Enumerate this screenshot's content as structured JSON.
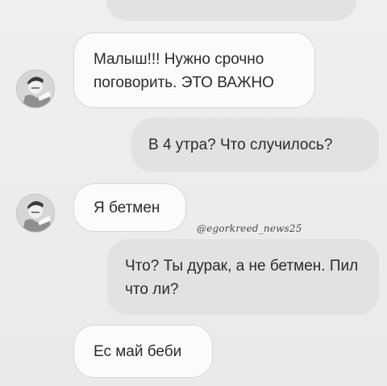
{
  "messages": [
    {
      "from": "them",
      "text": "Малыш!!! Нужно срочно поговорить. ЭТО ВАЖНО"
    },
    {
      "from": "me",
      "text": "В 4 утра? Что случилось?"
    },
    {
      "from": "them",
      "text": "Я бетмен"
    },
    {
      "from": "me",
      "text": "Что? Ты дурак, а не бетмен. Пил что ли?"
    },
    {
      "from": "them",
      "text": "Ес май беби"
    }
  ],
  "watermark": "@egorkreed_news25",
  "avatar": {
    "icon": "user-photo-icon"
  },
  "colors": {
    "background": "#ececeb",
    "incoming_bubble": "#fbfbfb",
    "outgoing_bubble": "#e2e2e1",
    "text": "#2b2b2b"
  }
}
